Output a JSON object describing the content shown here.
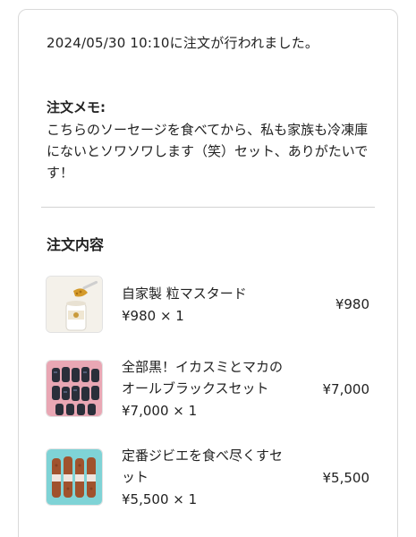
{
  "order": {
    "datetime_text": "2024/05/30 10:10に注文が行われました。"
  },
  "memo": {
    "title": "注文メモ:",
    "body": "こちらのソーセージを食べてから、私も家族も冷凍庫にないとソワソワします（笑）セット、ありがたいです！"
  },
  "contents": {
    "title": "注文内容",
    "items": [
      {
        "name": "自家製 粒マスタード",
        "qty": "¥980 × 1",
        "price": "¥980",
        "image_icon": "mustard-jar-image"
      },
      {
        "name": "全部黒！イカスミとマカのオールブラックスセット",
        "qty": "¥7,000 × 1",
        "price": "¥7,000",
        "image_icon": "black-sausage-image"
      },
      {
        "name": "定番ジビエを食べ尽くすセット",
        "qty": "¥5,500 × 1",
        "price": "¥5,500",
        "image_icon": "gibier-sausage-image"
      }
    ]
  },
  "colors": {
    "text": "#222222",
    "border": "#d9d9d9",
    "divider": "#d2d2d2",
    "thumb1_bg": "#f4f1ea",
    "thumb2_bg": "#e9a7b4",
    "thumb3_bg": "#7fd3d6"
  }
}
